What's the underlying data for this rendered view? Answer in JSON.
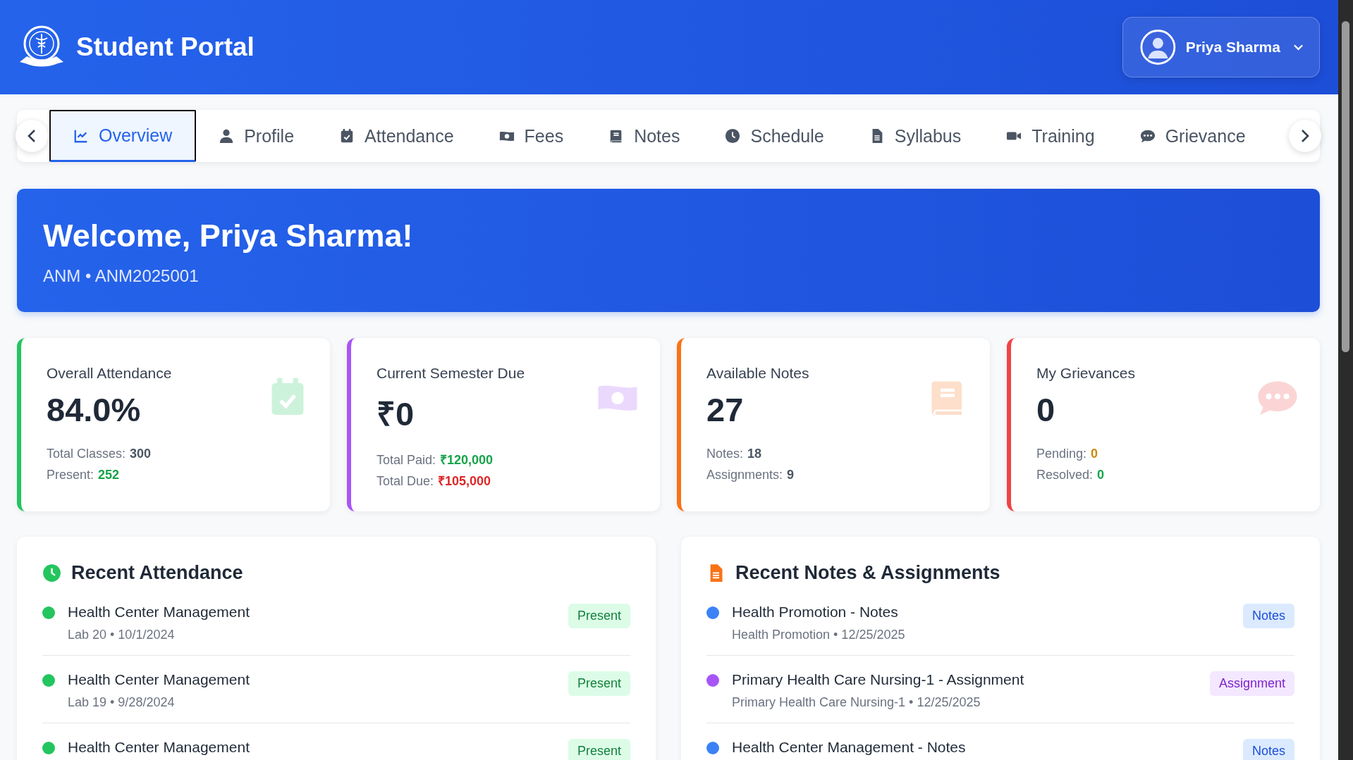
{
  "header": {
    "title": "Student Portal",
    "user": {
      "name": "Priya Sharma"
    }
  },
  "tabs": [
    {
      "label": "Overview",
      "selected": true
    },
    {
      "label": "Profile",
      "selected": false
    },
    {
      "label": "Attendance",
      "selected": false
    },
    {
      "label": "Fees",
      "selected": false
    },
    {
      "label": "Notes",
      "selected": false
    },
    {
      "label": "Schedule",
      "selected": false
    },
    {
      "label": "Syllabus",
      "selected": false
    },
    {
      "label": "Training",
      "selected": false
    },
    {
      "label": "Grievance",
      "selected": false
    }
  ],
  "welcome": {
    "title": "Welcome, Priya Sharma!",
    "subtitle": "ANM • ANM2025001"
  },
  "stats": [
    {
      "title": "Overall Attendance",
      "value": "84.0%",
      "color": "#22c55e",
      "lines": [
        {
          "label": "Total Classes:",
          "value": "300",
          "color": "#4b5563"
        },
        {
          "label": "Present:",
          "value": "252",
          "color": "#16a34a"
        }
      ]
    },
    {
      "title": "Current Semester Due",
      "value": "₹0",
      "color": "#a855f7",
      "lines": [
        {
          "label": "Total Paid:",
          "value": "₹120,000",
          "color": "#16a34a"
        },
        {
          "label": "Total Due:",
          "value": "₹105,000",
          "color": "#dc2626"
        }
      ]
    },
    {
      "title": "Available Notes",
      "value": "27",
      "color": "#f97316",
      "lines": [
        {
          "label": "Notes:",
          "value": "18",
          "color": "#4b5563"
        },
        {
          "label": "Assignments:",
          "value": "9",
          "color": "#4b5563"
        }
      ]
    },
    {
      "title": "My Grievances",
      "value": "0",
      "color": "#ef4444",
      "lines": [
        {
          "label": "Pending:",
          "value": "0",
          "color": "#ca8a04"
        },
        {
          "label": "Resolved:",
          "value": "0",
          "color": "#16a34a"
        }
      ]
    }
  ],
  "recent_attendance": {
    "title": "Recent Attendance",
    "items": [
      {
        "title": "Health Center Management",
        "subtitle": "Lab 20 • 10/1/2024",
        "status": "Present",
        "color": "#22c55e"
      },
      {
        "title": "Health Center Management",
        "subtitle": "Lab 19 • 9/28/2024",
        "status": "Present",
        "color": "#22c55e"
      },
      {
        "title": "Health Center Management",
        "status": "Present",
        "color": "#22c55e"
      }
    ]
  },
  "recent_notes": {
    "title": "Recent Notes & Assignments",
    "items": [
      {
        "title": "Health Promotion - Notes",
        "subtitle": "Health Promotion • 12/25/2025",
        "badge": "Notes",
        "kind": "notes",
        "color": "#3b82f6"
      },
      {
        "title": "Primary Health Care Nursing-1 - Assignment",
        "subtitle": "Primary Health Care Nursing-1 • 12/25/2025",
        "badge": "Assignment",
        "kind": "assignment",
        "color": "#a855f7"
      },
      {
        "title": "Health Center Management - Notes",
        "badge": "Notes",
        "kind": "notes",
        "color": "#3b82f6"
      }
    ]
  }
}
